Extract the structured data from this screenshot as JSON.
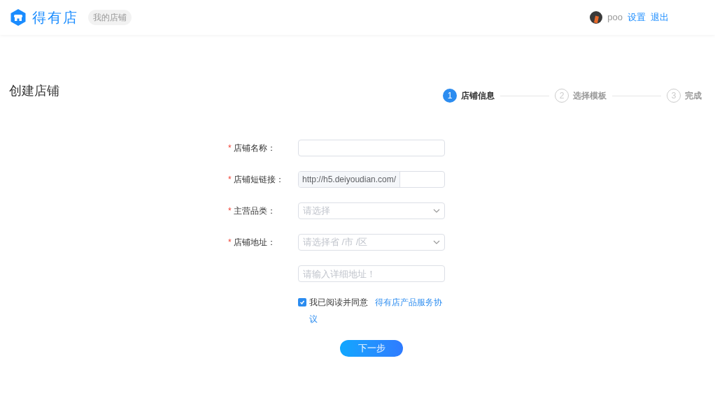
{
  "header": {
    "logo_text": "得有店",
    "badge": "我的店铺",
    "user": "poo",
    "links": [
      "设置",
      "退出"
    ]
  },
  "page_title": "创建店铺",
  "steps": [
    {
      "number": "1",
      "label": "店铺信息",
      "selected": true
    },
    {
      "number": "2",
      "label": "选择模板",
      "selected": false
    },
    {
      "number": "3",
      "label": "完成",
      "selected": false
    }
  ],
  "form": {
    "fields": [
      {
        "kind": "text",
        "required_mark": "*",
        "label": "店铺名称："
      },
      {
        "kind": "prefixed",
        "required_mark": "*",
        "label": "店铺短链接：",
        "prefix": "http://h5.deiyoudian.com/"
      },
      {
        "kind": "select",
        "required_mark": "*",
        "label": "主营品类：",
        "placeholder": "请选择"
      },
      {
        "kind": "select",
        "required_mark": "*",
        "label": "店铺地址：",
        "placeholder": "请选择省 /市 /区"
      },
      {
        "kind": "text",
        "placeholder": "请输入详细地址！"
      }
    ],
    "agreement": {
      "checked": true,
      "text": "我已阅读并同意",
      "link": "得有店产品服务协议"
    },
    "submit": "下一步"
  }
}
